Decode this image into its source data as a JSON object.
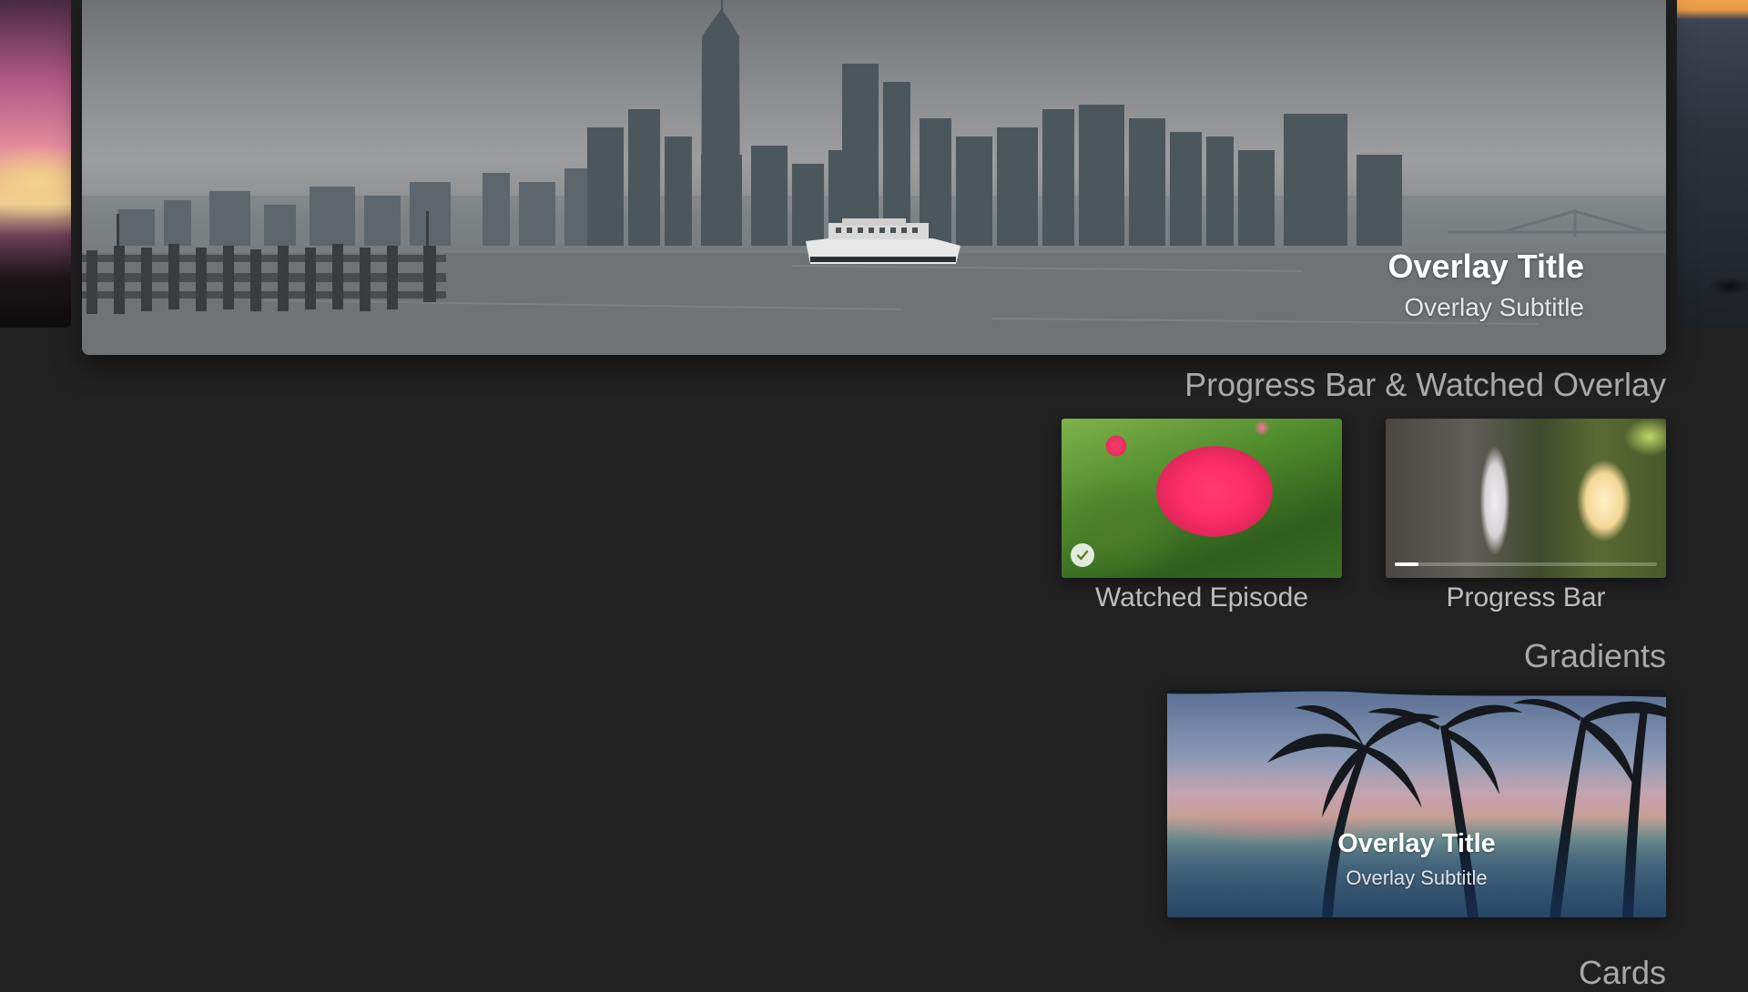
{
  "hero": {
    "overlay_title": "Overlay Title",
    "overlay_subtitle": "Overlay Subtitle"
  },
  "sections": {
    "progress_watched": "Progress Bar & Watched Overlay",
    "gradients": "Gradients",
    "cards": "Cards"
  },
  "episodes": [
    {
      "label": "Watched Episode",
      "watched": true,
      "icon": "checkmark-icon"
    },
    {
      "label": "Progress Bar",
      "progress": 0.09
    }
  ],
  "gradient_card": {
    "overlay_title": "Overlay Title",
    "overlay_subtitle": "Overlay Subtitle"
  },
  "colors": {
    "background": "#212121",
    "section_header": "#a9a9a9",
    "tile_label": "#bdbdbd"
  }
}
